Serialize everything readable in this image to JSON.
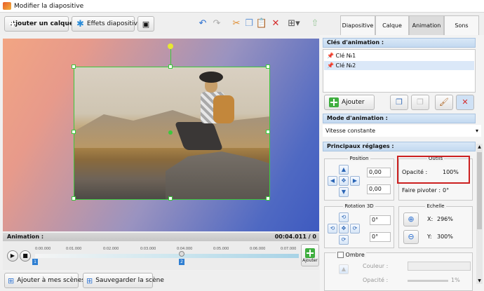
{
  "window": {
    "title": "Modifier la diapositive"
  },
  "toolbar": {
    "add_layer": "Ajouter un calque",
    "slide_effects": "Effets diapositive"
  },
  "tabs": [
    {
      "label": "Diapositive",
      "active": false
    },
    {
      "label": "Calque",
      "active": false
    },
    {
      "label": "Animation",
      "active": true
    },
    {
      "label": "Sons",
      "active": false
    }
  ],
  "timeline": {
    "header": "Animation :",
    "time": "00:04.011 / 0",
    "ticks": [
      "0:00.000",
      "0:01.000",
      "0:02.000",
      "0:03.000",
      "0:04.000",
      "0:05.000",
      "0:06.000",
      "0:07.000"
    ],
    "keys": [
      "1",
      "2"
    ],
    "add_label": "Ajouter"
  },
  "footer": {
    "add_to_scenes": "Ajouter à mes scènes",
    "save_scene": "Sauvegarder la scène"
  },
  "panel": {
    "keys_header": "Clés d'animation :",
    "keys": [
      {
        "label": "Clé №1",
        "selected": false
      },
      {
        "label": "Clé №2",
        "selected": true
      }
    ],
    "add_btn": "Ajouter",
    "mode_header": "Mode d'animation :",
    "mode_value": "Vitesse constante",
    "main_header": "Principaux réglages :",
    "position": {
      "title": "Position",
      "x": "0,00",
      "y": "0,00"
    },
    "outils": {
      "title": "Outils",
      "opacity_label": "Opacité :",
      "opacity_value": "100%",
      "rotate_label": "Faire pivoter :",
      "rotate_value": "0°"
    },
    "rotation3d": {
      "title": "Rotation 3D",
      "a": "0°",
      "b": "0°"
    },
    "scale": {
      "title": "Echelle",
      "x_label": "X:",
      "x_value": "296%",
      "y_label": "Y:",
      "y_value": "300%"
    },
    "shadow": {
      "label": "Ombre",
      "color_label": "Couleur :",
      "opacity_label": "Opacité :",
      "opacity_value": "1%"
    }
  },
  "colors": {
    "highlight": "#cc2020",
    "selection": "#3cc83c",
    "tab_active": "#dcdcdc"
  }
}
